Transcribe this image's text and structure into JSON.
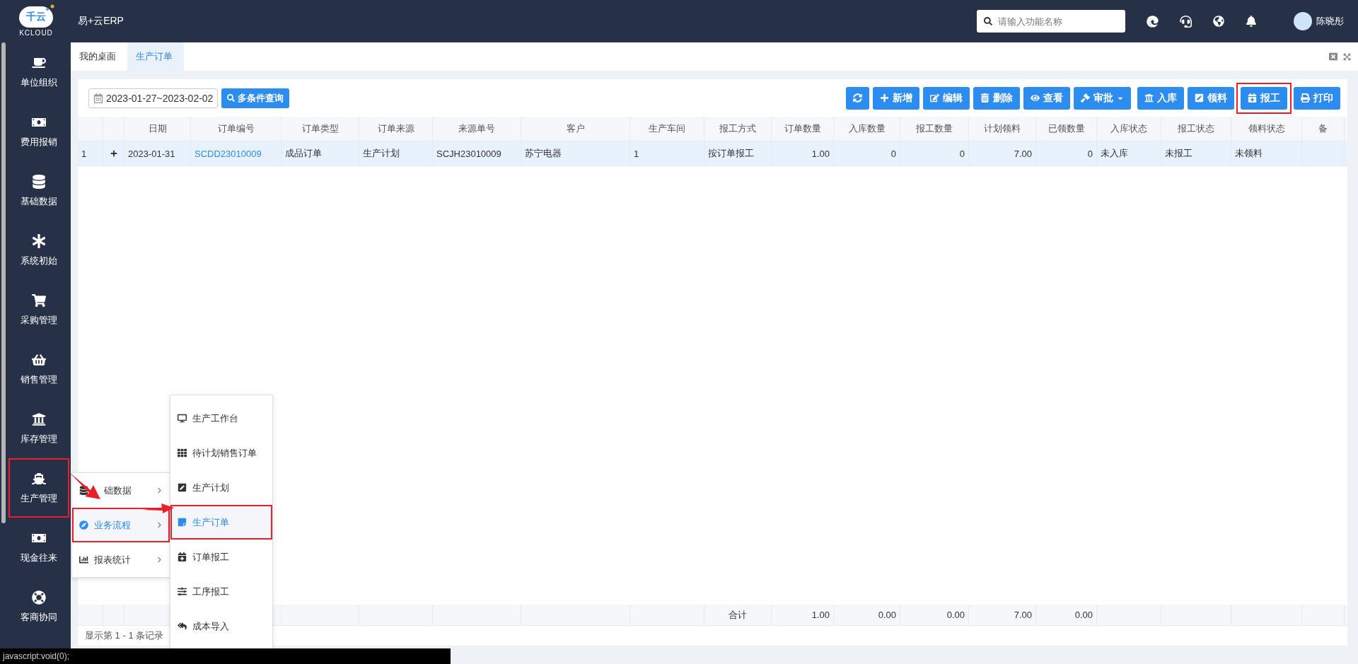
{
  "header": {
    "logo": {
      "text": "千云",
      "subtext": "KCLOUD"
    },
    "app_name": "易+云ERP",
    "search": {
      "placeholder": "请输入功能名称"
    },
    "user": {
      "name": "陈晓彤"
    }
  },
  "tabs": [
    {
      "label": "我的桌面",
      "selected": false
    },
    {
      "label": "生产订单",
      "selected": true
    }
  ],
  "sidebar": {
    "items": [
      {
        "label": "单位组织",
        "highlighted": false
      },
      {
        "label": "费用报销",
        "highlighted": false
      },
      {
        "label": "基础数据",
        "highlighted": false
      },
      {
        "label": "系统初始",
        "highlighted": false
      },
      {
        "label": "采购管理",
        "highlighted": false
      },
      {
        "label": "销售管理",
        "highlighted": false
      },
      {
        "label": "库存管理",
        "highlighted": false
      },
      {
        "label": "生产管理",
        "highlighted": true
      },
      {
        "label": "现金往来",
        "highlighted": false
      },
      {
        "label": "客商协同",
        "highlighted": false
      }
    ]
  },
  "flyout": {
    "items": [
      {
        "label": "础数据",
        "selected": false,
        "highlighted": false
      },
      {
        "label": "业务流程",
        "selected": true,
        "highlighted": true
      },
      {
        "label": "报表统计",
        "selected": false,
        "highlighted": false
      }
    ]
  },
  "submenu": {
    "items": [
      {
        "label": "生产工作台",
        "selected": false,
        "highlighted": false
      },
      {
        "label": "待计划销售订单",
        "selected": false,
        "highlighted": false
      },
      {
        "label": "生产计划",
        "selected": false,
        "highlighted": false
      },
      {
        "label": "生产订单",
        "selected": true,
        "highlighted": true
      },
      {
        "label": "订单报工",
        "selected": false,
        "highlighted": false
      },
      {
        "label": "工序报工",
        "selected": false,
        "highlighted": false
      },
      {
        "label": "成本导入",
        "selected": false,
        "highlighted": false
      }
    ]
  },
  "annotation_arrows": [
    {
      "kind": "arrow"
    },
    {
      "kind": "arrow"
    }
  ],
  "toolbar": {
    "date_range": "2023-01-27~2023-02-02",
    "query_button": "多条件查询",
    "buttons": [
      {
        "highlighted": false
      },
      {
        "label": "新增",
        "highlighted": false
      },
      {
        "label": "编辑",
        "highlighted": false
      },
      {
        "label": "删除",
        "highlighted": false
      },
      {
        "label": "查看",
        "highlighted": false
      },
      {
        "label": "审批",
        "highlighted": false
      },
      {
        "label": "入库",
        "highlighted": false
      },
      {
        "label": "领料",
        "highlighted": false
      },
      {
        "label": "报工",
        "highlighted": true
      },
      {
        "label": "打印",
        "highlighted": false
      }
    ]
  },
  "table": {
    "columns": [
      {
        "label": "日期",
        "kind": "text"
      },
      {
        "label": "订单编号",
        "kind": "link"
      },
      {
        "label": "订单类型",
        "kind": "text"
      },
      {
        "label": "订单来源",
        "kind": "text"
      },
      {
        "label": "来源单号",
        "kind": "text"
      },
      {
        "label": "客户",
        "kind": "text"
      },
      {
        "label": "生产车间",
        "kind": "text"
      },
      {
        "label": "报工方式",
        "kind": "text"
      },
      {
        "label": "订单数量",
        "kind": "number"
      },
      {
        "label": "入库数量",
        "kind": "number"
      },
      {
        "label": "报工数量",
        "kind": "number"
      },
      {
        "label": "计划领料",
        "kind": "number"
      },
      {
        "label": "已领数量",
        "kind": "number"
      },
      {
        "label": "入库状态",
        "kind": "text"
      },
      {
        "label": "报工状态",
        "kind": "text"
      },
      {
        "label": "领料状态",
        "kind": "text"
      },
      {
        "label": "备",
        "kind": "text"
      }
    ],
    "rows": [
      {
        "index": "1",
        "expanded": false,
        "selected": true,
        "cells": [
          "2023-01-31",
          "SCDD23010009",
          "成品订单",
          "生产计划",
          "SCJH23010009",
          "苏宁电器",
          "1",
          "按订单报工",
          "1.00",
          "0",
          "0",
          "7.00",
          "0",
          "未入库",
          "未报工",
          "未领料"
        ]
      }
    ],
    "totals": {
      "label": "合计",
      "values": [
        "1.00",
        "0.00",
        "0.00",
        "7.00",
        "0.00"
      ]
    },
    "pagination": "显示第 1 - 1 条记录"
  },
  "status_bar": "javascript:void(0);"
}
